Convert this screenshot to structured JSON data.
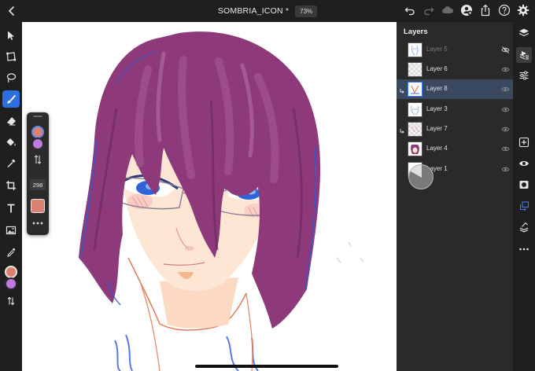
{
  "app": {
    "document_title": "SOMBRIA_ICON *",
    "zoom": "73%"
  },
  "topbar": {
    "icons": [
      "back-chevron-icon",
      "undo-icon",
      "redo-icon",
      "cloud-icon",
      "add-person-icon",
      "share-icon",
      "help-icon",
      "settings-gear-icon"
    ]
  },
  "left_toolbar": {
    "tools": [
      "select-arrow-icon",
      "transform-icon",
      "lasso-icon",
      "brush-icon",
      "eraser-icon",
      "paint-bucket-icon",
      "eyedropper-fill-icon",
      "crop-icon",
      "text-icon",
      "image-icon",
      "eyedropper-icon"
    ],
    "active_tool": "brush-icon",
    "primary_color": "#dc8071",
    "secondary_color": "#c07ae0"
  },
  "brush_panel": {
    "brush_size": "298",
    "primary_color": "#dc8071",
    "secondary_color": "#c07ae0",
    "selected_color": "#dc8071"
  },
  "layers_panel": {
    "title": "Layers",
    "layers": [
      {
        "name": "Layer 5",
        "visible": false,
        "selected": false,
        "clipped": false
      },
      {
        "name": "Layer 6",
        "visible": true,
        "selected": false,
        "clipped": false
      },
      {
        "name": "Layer 8",
        "visible": true,
        "selected": true,
        "clipped": true
      },
      {
        "name": "Layer 3",
        "visible": true,
        "selected": false,
        "clipped": false
      },
      {
        "name": "Layer 7",
        "visible": true,
        "selected": false,
        "clipped": true
      },
      {
        "name": "Layer 4",
        "visible": true,
        "selected": false,
        "clipped": false
      },
      {
        "name": "Layer 1",
        "visible": true,
        "selected": false,
        "clipped": false
      }
    ]
  },
  "right_toolbar": {
    "tools": [
      "layers-icon",
      "layer-properties-icon",
      "adjustments-icon",
      "add-layer-icon",
      "visibility-icon",
      "mask-icon",
      "clip-icon",
      "merge-icon",
      "more-icon"
    ],
    "active_tool": "layer-properties-icon"
  },
  "colors": {
    "accent": "#2d6ee0",
    "hair": "#8e3a7a",
    "skin": "#fbe2cc",
    "lineart_blue": "#2c5ad8",
    "sketch_red": "#e07a5a"
  }
}
